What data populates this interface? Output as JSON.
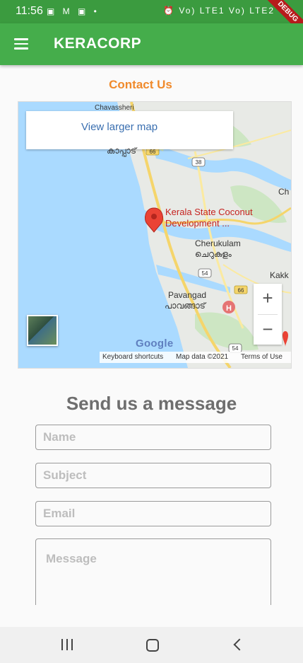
{
  "status_bar": {
    "time": "11:56",
    "left_icons": "▣ M ▣ •",
    "right_icons": "⏰ Vo) LTE1 Vo) LTE2",
    "debug_label": "DEBUG"
  },
  "app_bar": {
    "title": "KERACORP"
  },
  "contact": {
    "title": "Contact Us"
  },
  "map": {
    "larger_map_link": "View larger map",
    "poi_name_line1": "Kerala State Coconut",
    "poi_name_line2": "Development ...",
    "places": [
      "Chavassheri",
      "കാപ്പാട്",
      "Cherukulam",
      "ചെറുകുളം",
      "Pavangad",
      "പാവങ്ങാട്",
      "Ch",
      "Kakk"
    ],
    "road_labels": [
      "66",
      "38",
      "54",
      "66",
      "54"
    ],
    "zoom_in": "+",
    "zoom_out": "−",
    "google": "Google",
    "footer": {
      "shortcuts": "Keyboard shortcuts",
      "data": "Map data ©2021",
      "terms": "Terms of Use"
    },
    "colors": {
      "water": "#aadaff",
      "land": "#e8eae6",
      "green": "#cde6c3",
      "road": "#f5d56b",
      "marker": "#ea4335"
    }
  },
  "form": {
    "title": "Send us a  message",
    "name_placeholder": "Name",
    "subject_placeholder": "Subject",
    "email_placeholder": "Email",
    "message_placeholder": "Message"
  },
  "nav": {
    "recents": "recents-icon",
    "home": "home-icon",
    "back": "back-icon"
  }
}
